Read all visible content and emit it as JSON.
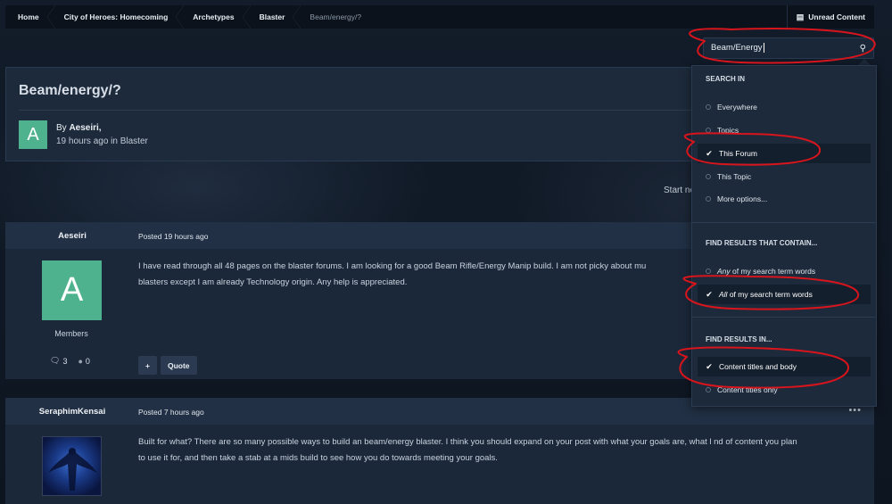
{
  "breadcrumb": {
    "items": [
      "Home",
      "City of Heroes: Homecoming",
      "Archetypes",
      "Blaster"
    ],
    "current": "Beam/energy/?"
  },
  "header": {
    "unread_label": "Unread Content"
  },
  "search": {
    "value": "Beam/Energy"
  },
  "topic": {
    "title": "Beam/energy/?",
    "author_prefix": "By",
    "author": "Aeseiri,",
    "meta": "19 hours ago in Blaster",
    "avatar_letter": "A"
  },
  "start_new_partial": "Start ne",
  "posts": [
    {
      "author": "Aeseiri",
      "posted": "Posted 19 hours ago",
      "avatar_letter": "A",
      "group": "Members",
      "comments": "3",
      "reputation": "0",
      "body_line1": "I have read through all 48 pages on the blaster forums. I am looking for a good Beam Rifle/Energy Manip build. I am not picky about mu",
      "body_line2": "blasters except I am already Technology origin. Any help is appreciated.",
      "plus_label": "+",
      "quote_label": "Quote"
    },
    {
      "author": "SeraphimKensai",
      "posted": "Posted 7 hours ago",
      "more": "•••",
      "body_line1": "Built for what? There are so many possible ways to build an beam/energy blaster. I think you should expand on your post with what your goals are, what l nd of content you plan",
      "body_line2": "to use it for, and then take a stab at a mids build to see how you do towards meeting your goals."
    }
  ],
  "dropdown": {
    "search_in_heading": "Search in",
    "search_in": [
      {
        "label": "Everywhere",
        "selected": false
      },
      {
        "label": "Topics",
        "selected": false
      },
      {
        "label": "This Forum",
        "selected": true
      },
      {
        "label": "This Topic",
        "selected": false
      },
      {
        "label": "More options...",
        "selected": false
      }
    ],
    "contain_heading": "Find results that contain...",
    "contain_any_em": "Any",
    "contain_any_rest": " of my search term words",
    "contain_all_em": "All",
    "contain_all_rest": " of my search term words",
    "results_in_heading": "Find results in...",
    "results_in": [
      {
        "label": "Content titles and body",
        "selected": true
      },
      {
        "label": "Content titles only",
        "selected": false
      }
    ]
  },
  "colors": {
    "accent_green": "#4fb28e",
    "annotation_red": "#d8141c",
    "panel": "#1d2a3b"
  }
}
